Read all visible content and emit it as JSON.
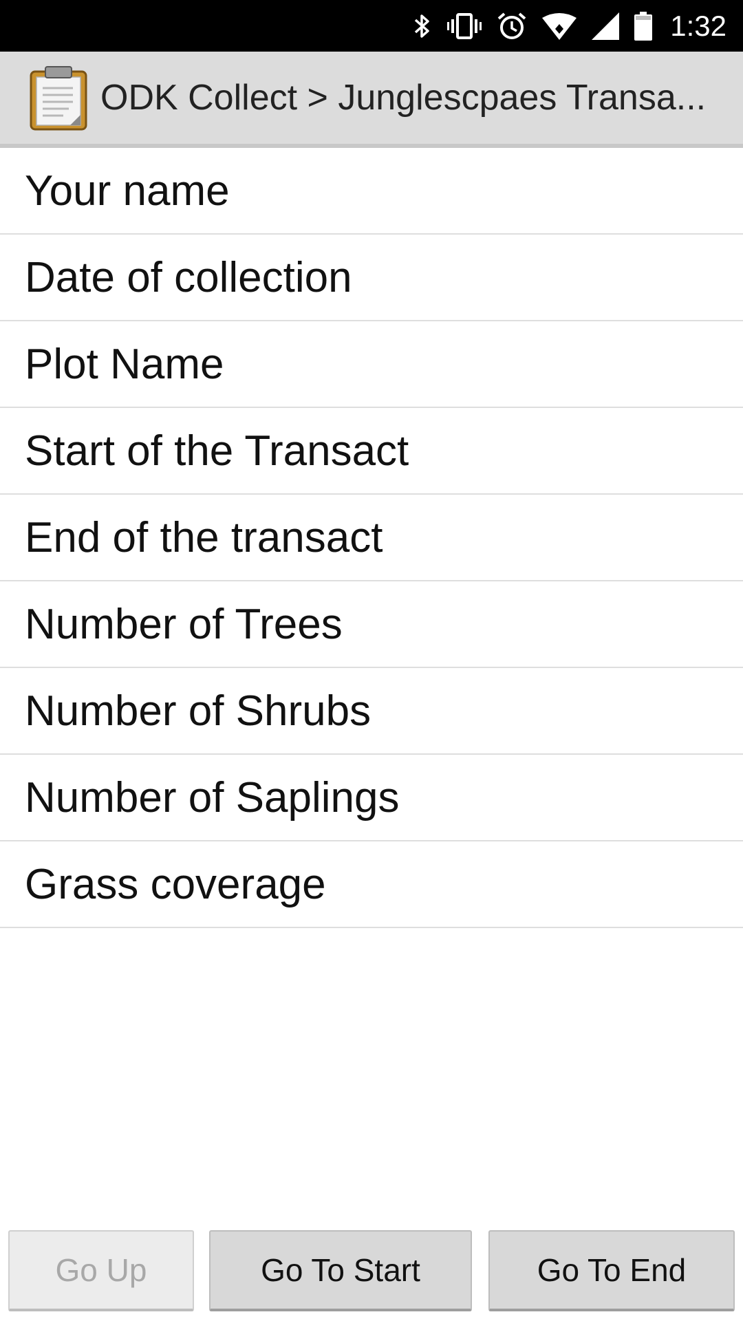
{
  "status_bar": {
    "time": "1:32",
    "icons": [
      "bluetooth-icon",
      "vibrate-icon",
      "alarm-icon",
      "wifi-icon",
      "cell-signal-icon",
      "battery-icon"
    ]
  },
  "title_bar": {
    "app_icon": "clipboard-icon",
    "title": "ODK Collect > Junglescpaes Transa..."
  },
  "hierarchy_list": {
    "items": [
      {
        "label": "Your name"
      },
      {
        "label": "Date of collection"
      },
      {
        "label": "Plot Name"
      },
      {
        "label": "Start of the Transact"
      },
      {
        "label": "End of the transact"
      },
      {
        "label": "Number of Trees"
      },
      {
        "label": "Number of Shrubs"
      },
      {
        "label": "Number of Saplings"
      },
      {
        "label": "Grass coverage"
      }
    ]
  },
  "buttons": {
    "go_up": {
      "label": "Go Up",
      "enabled": false
    },
    "go_to_start": {
      "label": "Go To Start",
      "enabled": true
    },
    "go_to_end": {
      "label": "Go To End",
      "enabled": true
    }
  },
  "colors": {
    "status_bar_bg": "#000000",
    "title_bar_bg": "#dcdcdc",
    "button_bg": "#d8d8d8",
    "disabled_text": "#a8a8a8"
  }
}
